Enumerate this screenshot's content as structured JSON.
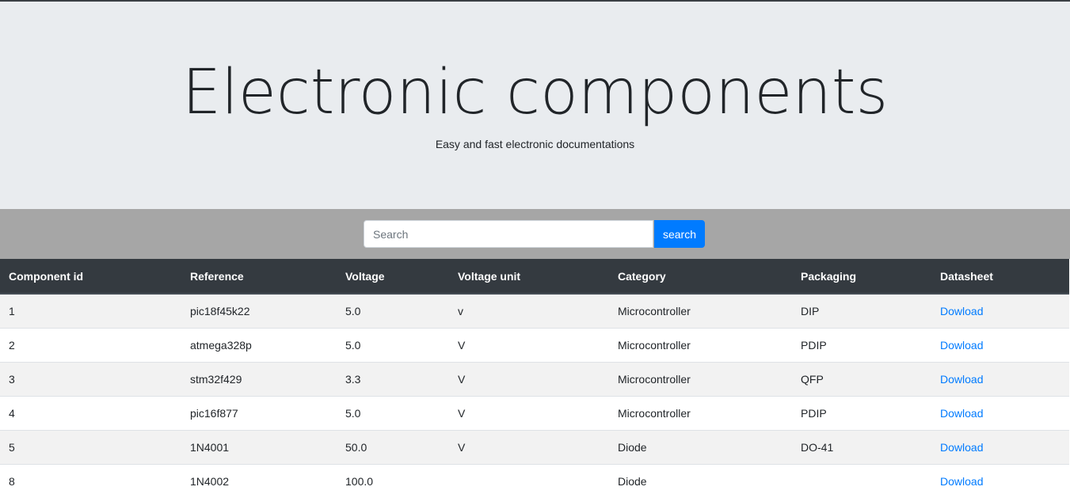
{
  "header": {
    "title": "Electronic components",
    "subtitle": "Easy and fast electronic documentations"
  },
  "search": {
    "placeholder": "Search",
    "value": "",
    "button_label": "search"
  },
  "table": {
    "columns": [
      "Component id",
      "Reference",
      "Voltage",
      "Voltage unit",
      "Category",
      "Packaging",
      "Datasheet"
    ],
    "rows": [
      {
        "id": "1",
        "reference": "pic18f45k22",
        "voltage": "5.0",
        "unit": "v",
        "category": "Microcontroller",
        "packaging": "DIP",
        "datasheet": "Dowload"
      },
      {
        "id": "2",
        "reference": "atmega328p",
        "voltage": "5.0",
        "unit": "V",
        "category": "Microcontroller",
        "packaging": "PDIP",
        "datasheet": "Dowload"
      },
      {
        "id": "3",
        "reference": "stm32f429",
        "voltage": "3.3",
        "unit": "V",
        "category": "Microcontroller",
        "packaging": "QFP",
        "datasheet": "Dowload"
      },
      {
        "id": "4",
        "reference": "pic16f877",
        "voltage": "5.0",
        "unit": "V",
        "category": "Microcontroller",
        "packaging": "PDIP",
        "datasheet": "Dowload"
      },
      {
        "id": "5",
        "reference": "1N4001",
        "voltage": "50.0",
        "unit": "V",
        "category": "Diode",
        "packaging": "DO-41",
        "datasheet": "Dowload"
      },
      {
        "id": "8",
        "reference": "1N4002",
        "voltage": "100.0",
        "unit": "",
        "category": "Diode",
        "packaging": "",
        "datasheet": "Dowload"
      }
    ]
  },
  "colors": {
    "jumbotron_bg": "#e9ecef",
    "searchbar_bg": "#a6a6a6",
    "primary": "#007bff",
    "table_header_bg": "#343a40",
    "striped_row_bg": "#f2f2f2"
  }
}
